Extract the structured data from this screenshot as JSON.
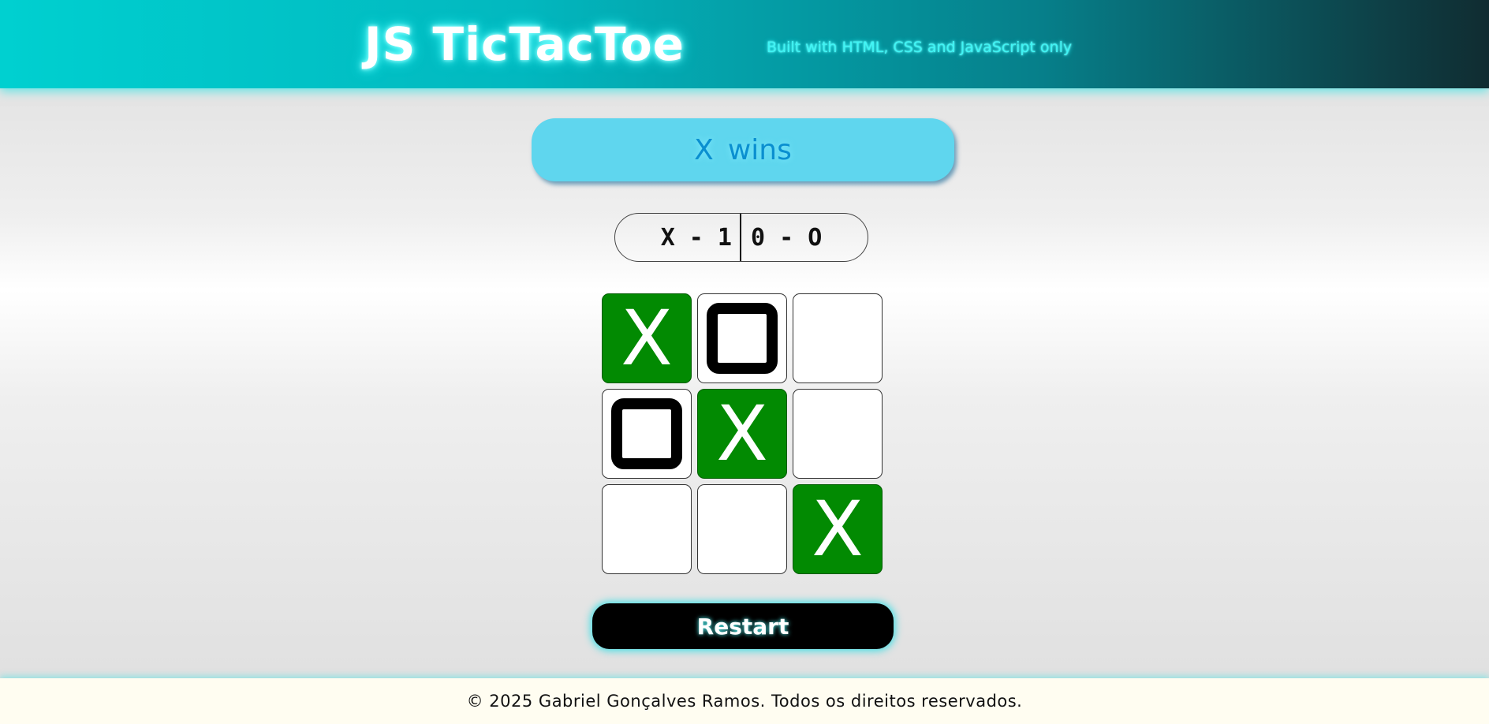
{
  "header": {
    "title": "JS TicTacToe",
    "subtitle": "Built with HTML, CSS and JavaScript only"
  },
  "status": {
    "player": "X",
    "text": "wins"
  },
  "scoreboard": {
    "x_score": "X - 1",
    "o_score": "0 - O"
  },
  "board": {
    "cells": [
      "X",
      "O",
      "",
      "O",
      "X",
      "",
      "",
      "",
      "X"
    ],
    "winning_cells": [
      0,
      4,
      8
    ]
  },
  "restart_label": "Restart",
  "footer": {
    "copyright": "© 2025 Gabriel Gonçalves Ramos. Todos os direitos reservados."
  },
  "colors": {
    "win_cell": "#028a02",
    "status_bg": "#5fd6ee",
    "accent_glow": "#00e6e6"
  }
}
